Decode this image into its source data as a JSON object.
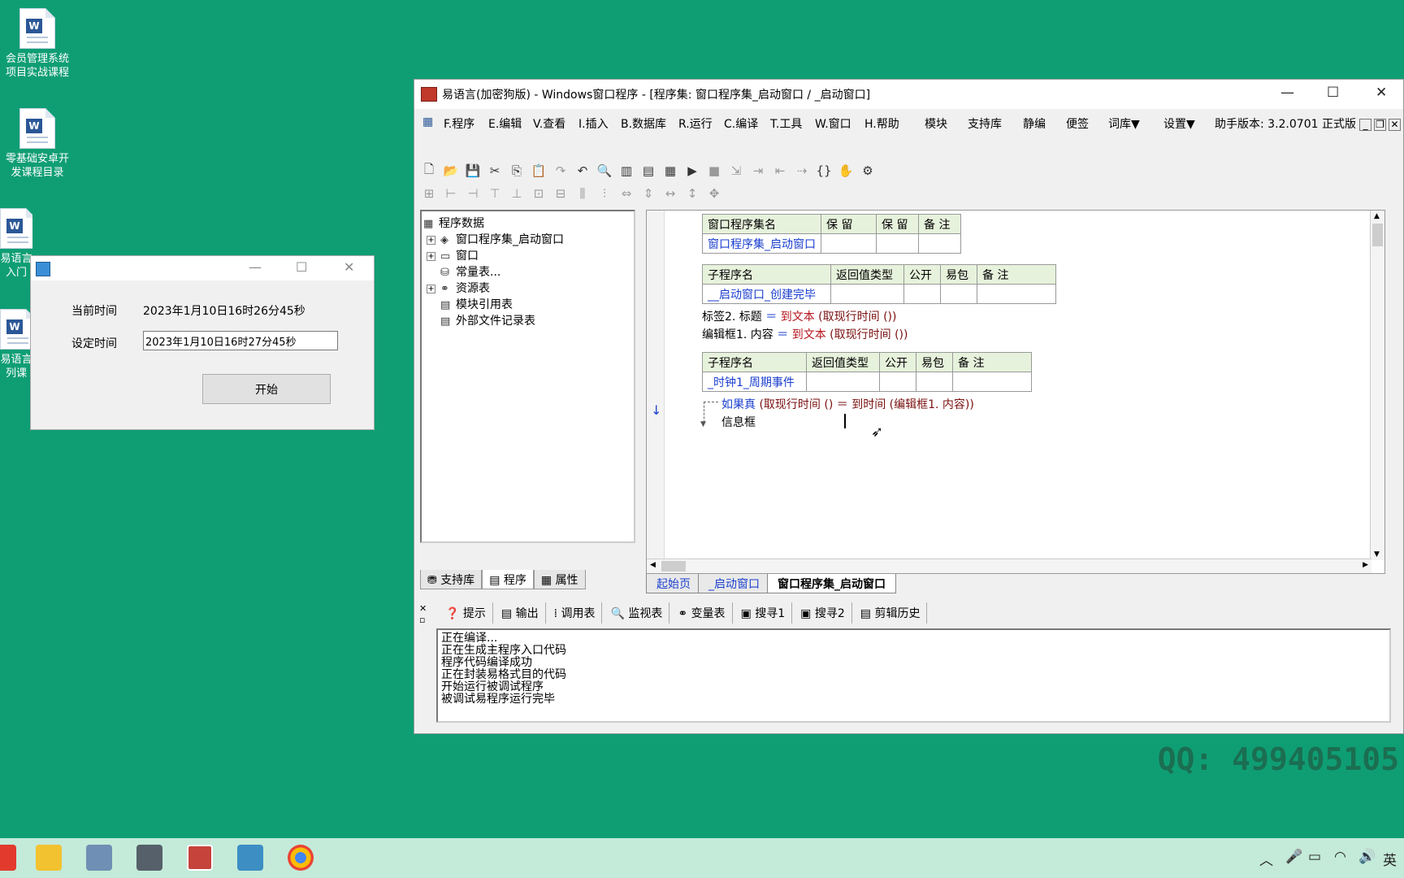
{
  "desktop": {
    "icons": [
      {
        "label_l1": "会员管理系统",
        "label_l2": "项目实战课程"
      },
      {
        "label_l1": "零基础安卓开",
        "label_l2": "发课程目录"
      },
      {
        "label_l1": "易语言",
        "label_l2": "入门"
      },
      {
        "label_l1": "易语言",
        "label_l2": "列课"
      }
    ]
  },
  "timer_window": {
    "current_label": "当前时间",
    "current_value": "2023年1月10日16时26分45秒",
    "set_label": "设定时间",
    "set_value": "2023年1月10日16时27分45秒",
    "start_button": "开始"
  },
  "ide": {
    "title": "易语言(加密狗版) - Windows窗口程序 - [程序集: 窗口程序集_启动窗口 / _启动窗口]",
    "menu": [
      "F.程序",
      "E.编辑",
      "V.查看",
      "I.插入",
      "B.数据库",
      "R.运行",
      "C.编译",
      "T.工具",
      "W.窗口",
      "H.帮助",
      "模块",
      "支持库",
      "静编",
      "便签",
      "词库▼",
      "设置▼"
    ],
    "helper_version": "助手版本: 3.2.0701 正式版",
    "tree": {
      "root": "程序数据",
      "items": [
        "窗口程序集_启动窗口",
        "窗口",
        "常量表...",
        "资源表",
        "模块引用表",
        "外部文件记录表"
      ]
    },
    "left_tabs": [
      "支持库",
      "程序",
      "属性"
    ],
    "code": {
      "class_table": {
        "headers": [
          "窗口程序集名",
          "保 留",
          "保 留",
          "备 注"
        ],
        "row": [
          "窗口程序集_启动窗口",
          "",
          "",
          ""
        ]
      },
      "sub1_table": {
        "headers": [
          "子程序名",
          "返回值类型",
          "公开",
          "易包",
          "备 注"
        ],
        "row": [
          "__启动窗口_创建完毕",
          "",
          "",
          "",
          ""
        ]
      },
      "line1_a": "标签2. 标题",
      "line1_b": "＝",
      "line1_c": "到文本",
      "line1_d": "(取现行时间 ())",
      "line2_a": "编辑框1. 内容",
      "line2_b": "＝",
      "line2_c": "到文本",
      "line2_d": "(取现行时间 ())",
      "sub2_table": {
        "headers": [
          "子程序名",
          "返回值类型",
          "公开",
          "易包",
          "备 注"
        ],
        "row": [
          "_时钟1_周期事件",
          "",
          "",
          "",
          ""
        ]
      },
      "if_a": "如果真",
      "if_b": "(取现行时间 () ＝ 到时间 (编辑框1. 内容))",
      "if_body": "信息框"
    },
    "editor_tabs": [
      "起始页",
      "_启动窗口",
      "窗口程序集_启动窗口"
    ],
    "output_tabs": [
      "提示",
      "输出",
      "调用表",
      "监视表",
      "变量表",
      "搜寻1",
      "搜寻2",
      "剪辑历史"
    ],
    "output_lines": [
      "正在编译...",
      "正在生成主程序入口代码",
      "程序代码编译成功",
      "正在封装易格式目的代码",
      "开始运行被调试程序",
      "被调试易程序运行完毕"
    ]
  },
  "watermark": "QQ: 499405105",
  "taskbar": {
    "lang": "英"
  }
}
